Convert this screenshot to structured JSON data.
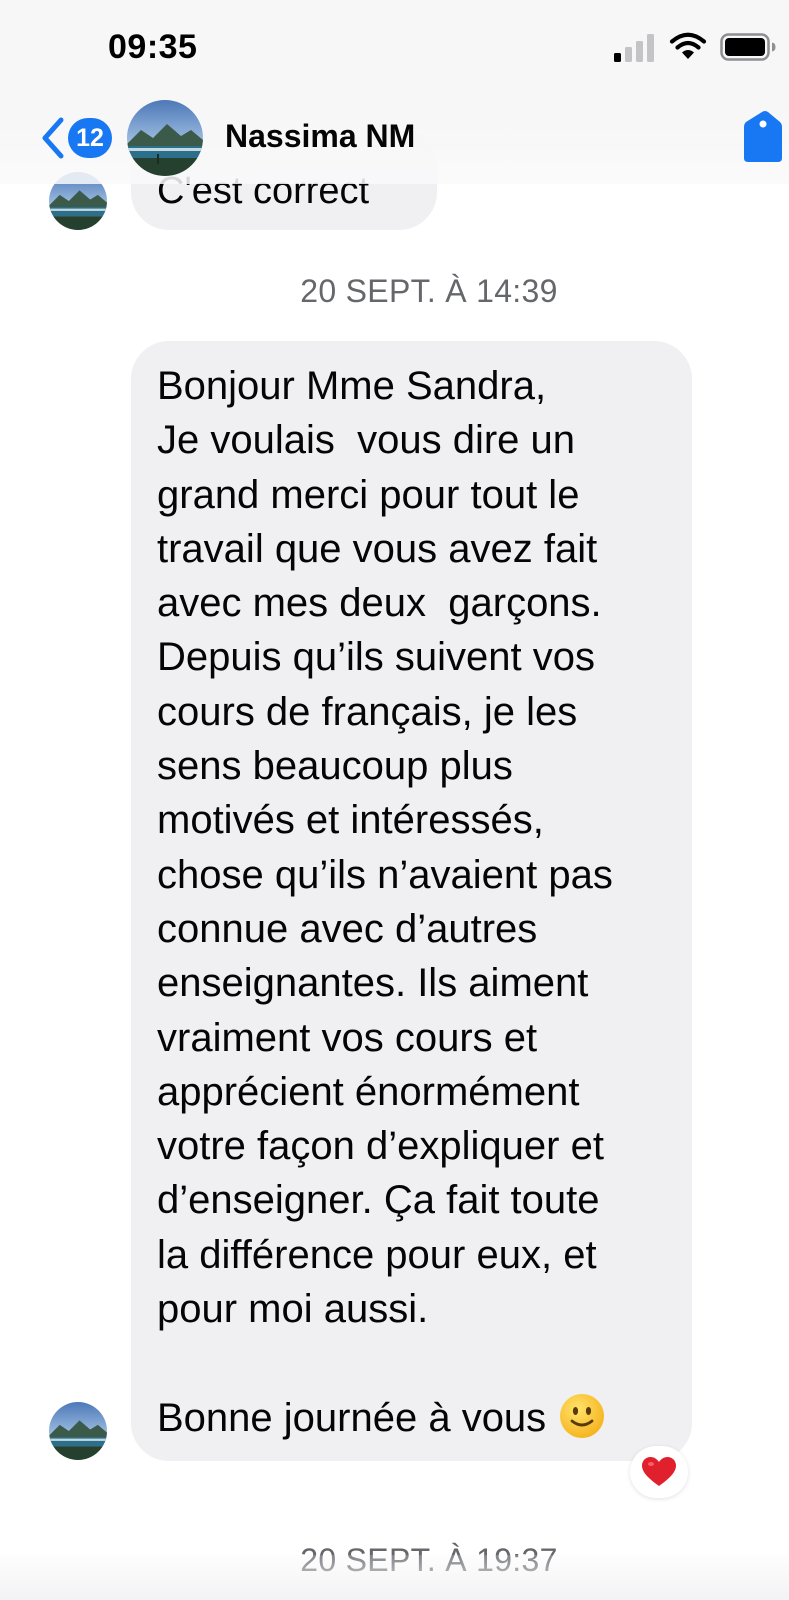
{
  "status_bar": {
    "time": "09:35",
    "icons": [
      "signal-icon",
      "wifi-icon",
      "battery-icon"
    ]
  },
  "header": {
    "back_badge_count": "12",
    "contact_name": "Nassima NM",
    "back_icon": "chevron-left-icon",
    "avatar": "landscape-avatar",
    "right_icon": "tag-icon"
  },
  "conversation": {
    "previous_message": "C'est correct",
    "timestamp": "20 SEPT. À 14:39",
    "message_lines": [
      "Bonjour Mme Sandra,",
      "Je voulais  vous dire un",
      "grand merci pour tout le",
      "travail que vous avez fait",
      "avec mes deux  garçons.",
      "Depuis qu’ils suivent vos",
      "cours de français, je les",
      "sens beaucoup plus",
      "motivés et intéressés,",
      "chose qu’ils n’avaient pas",
      "connue avec d’autres",
      "enseignantes. Ils aiment",
      "vraiment vos cours et",
      "apprécient énormément",
      "votre façon d’expliquer et",
      "d’enseigner. Ça fait toute",
      "la différence pour eux, et",
      "pour moi aussi."
    ],
    "closing_line": "Bonne journée à vous",
    "closing_emoji": "slightly-smiling-face-emoji",
    "reaction": "heart-reaction",
    "next_timestamp": "20 SEPT. À 19:37"
  },
  "colors": {
    "accent": "#1877f2",
    "bubble": "#f0f0f3",
    "timestamp": "#65676b",
    "heart": "#e0202c"
  }
}
